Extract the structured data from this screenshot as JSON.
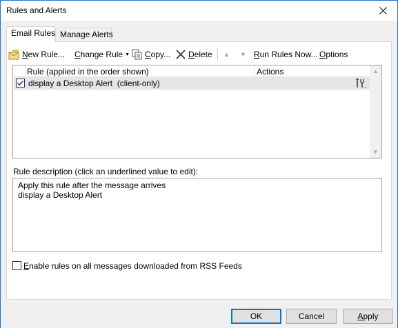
{
  "window": {
    "title": "Rules and Alerts"
  },
  "tabs": [
    {
      "label": "Email Rules",
      "active": true
    },
    {
      "label": "Manage Alerts",
      "active": false
    }
  ],
  "toolbar": {
    "new_rule": "New Rule...",
    "change_rule": "Change Rule",
    "copy": "Copy...",
    "delete": "Delete",
    "run_rules_now": "Run Rules Now...",
    "options": "Options"
  },
  "rules_list": {
    "columns": [
      "Rule (applied in the order shown)",
      "Actions"
    ],
    "rows": [
      {
        "checked": true,
        "name": "display a Desktop Alert  (client-only)"
      }
    ]
  },
  "description": {
    "label": "Rule description (click an underlined value to edit):",
    "lines": [
      "Apply this rule after the message arrives",
      "display a Desktop Alert"
    ]
  },
  "rss_checkbox": {
    "label": "Enable rules on all messages downloaded from RSS Feeds",
    "checked": false
  },
  "buttons": {
    "ok": "OK",
    "cancel": "Cancel",
    "apply": "Apply"
  },
  "colors": {
    "accent": "#0078d7",
    "selected_row": "#e5e5e5",
    "border": "#1f74c7"
  }
}
